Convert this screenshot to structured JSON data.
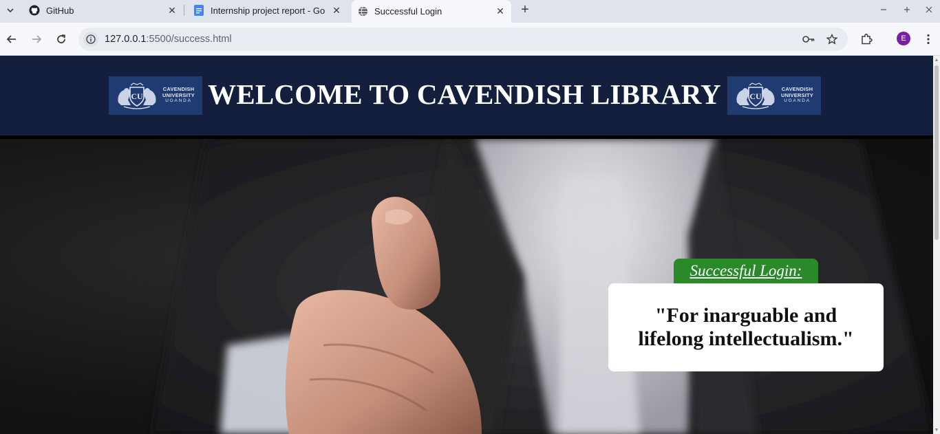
{
  "browser": {
    "tabs": [
      {
        "title": "GitHub",
        "favicon": "github-icon",
        "active": false
      },
      {
        "title": "Internship project report - Go",
        "favicon": "google-docs-icon",
        "active": false
      },
      {
        "title": "Successful Login",
        "favicon": "globe-icon",
        "active": true
      }
    ],
    "url": {
      "host": "127.0.0.1",
      "rest": ":5500/success.html"
    },
    "profile_initial": "E"
  },
  "page": {
    "header_title": "WELCOME TO CAVENDISH LIBRARY",
    "logo": {
      "line1": "CAVENDISH",
      "line2": "UNIVERSITY",
      "line3": "UGANDA"
    },
    "badge_text": "Successful Login:",
    "quote": "\"For inarguable and lifelong intellectualism.\""
  },
  "colors": {
    "header_bg": "#131f3d",
    "logo_bg": "#203a72",
    "badge_bg": "#2a8a2a",
    "card_bg": "#ffffff",
    "profile_bg": "#7b1fa2"
  }
}
